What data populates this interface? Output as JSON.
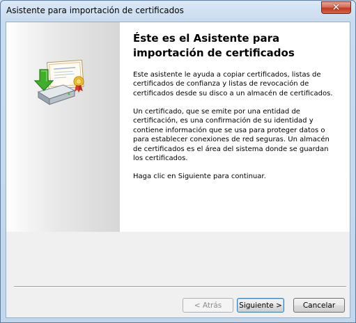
{
  "window": {
    "title": "Asistente para importación de certificados",
    "close_symbol": "✕"
  },
  "main": {
    "heading": "Éste es el Asistente para importación de certificados",
    "paragraphs": [
      "Este asistente le ayuda a copiar certificados, listas de certificados de confianza y listas de revocación de certificados desde su disco a un almacén de certificados.",
      "Un certificado, que se emite por una entidad de certificación, es una confirmación de su identidad y contiene información que se usa para proteger datos o para establecer conexiones de red seguras. Un almacén de certificados es el área del sistema donde se guardan los certificados.",
      "Haga clic en Siguiente para continuar."
    ]
  },
  "side": {
    "icon": "certificate-import-icon"
  },
  "buttons": {
    "back": "< Atrás",
    "next": "Siguiente >",
    "cancel": "Cancelar"
  },
  "colors": {
    "window_frame": "#c3d7ec",
    "close_button": "#c2381f",
    "default_button_border": "#3c7fb1"
  }
}
